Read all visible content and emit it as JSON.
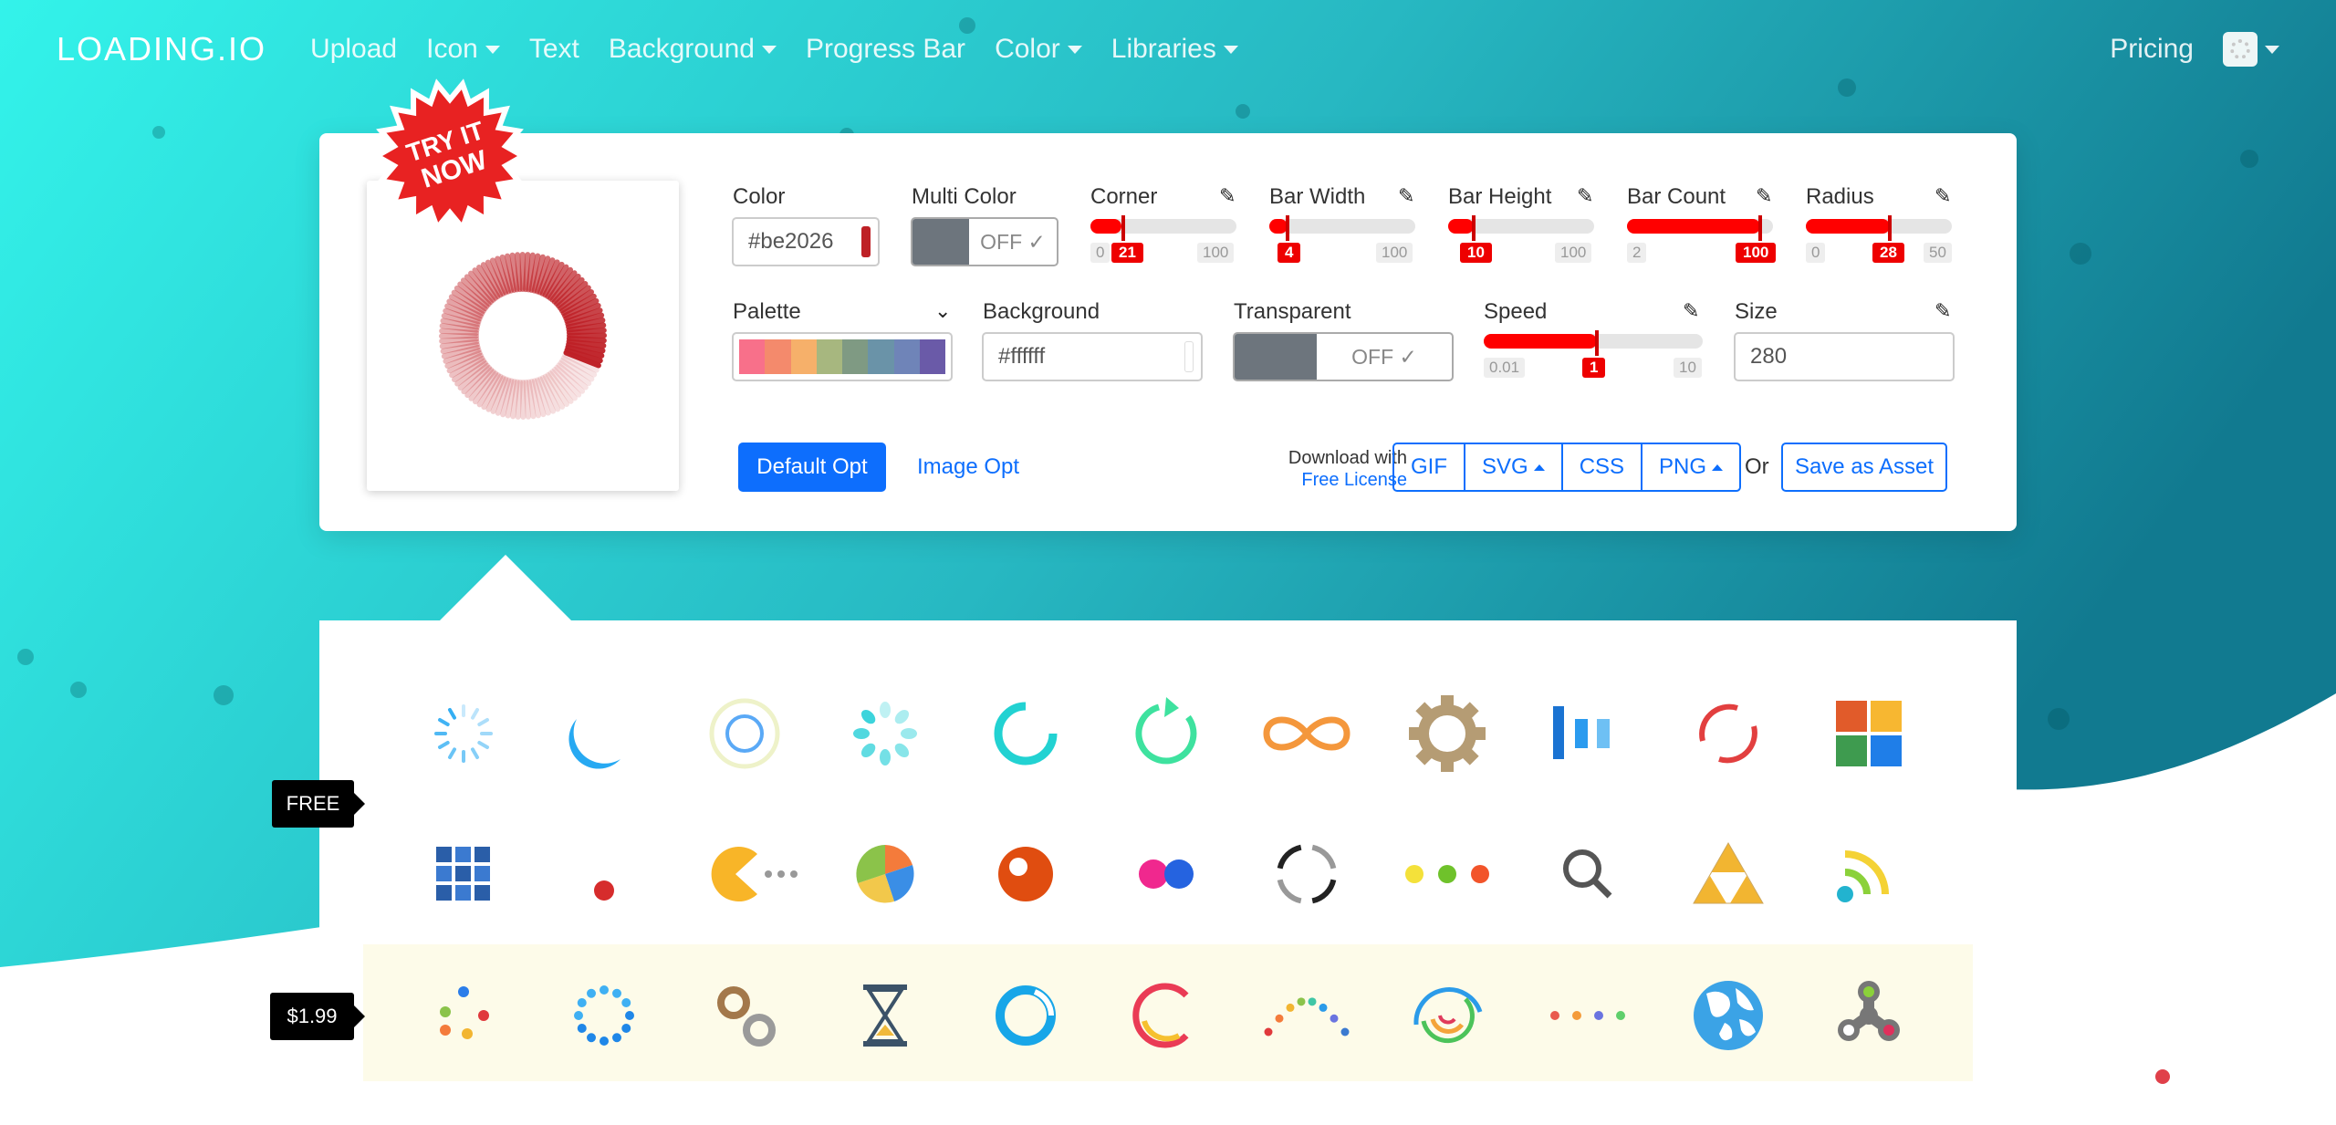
{
  "nav": {
    "logo": "LOADING.IO",
    "items": [
      {
        "label": "Upload",
        "dropdown": false
      },
      {
        "label": "Icon",
        "dropdown": true
      },
      {
        "label": "Text",
        "dropdown": false
      },
      {
        "label": "Background",
        "dropdown": true
      },
      {
        "label": "Progress Bar",
        "dropdown": false
      },
      {
        "label": "Color",
        "dropdown": true
      },
      {
        "label": "Libraries",
        "dropdown": true
      }
    ],
    "pricing": "Pricing"
  },
  "badge": {
    "line1": "TRY IT",
    "line2": "NOW"
  },
  "controls": {
    "color": {
      "label": "Color",
      "value": "#be2026"
    },
    "multi_color": {
      "label": "Multi Color",
      "value": "OFF"
    },
    "corner": {
      "label": "Corner",
      "min": "0",
      "max": "100",
      "value": "21",
      "fraction": 0.21
    },
    "bar_width": {
      "label": "Bar Width",
      "min": "0",
      "max": "100",
      "value": "4",
      "fraction": 0.04
    },
    "bar_height": {
      "label": "Bar Height",
      "min": "0",
      "max": "100",
      "value": "10",
      "fraction": 0.1
    },
    "bar_count": {
      "label": "Bar Count",
      "min": "2",
      "max": "100",
      "value": "100",
      "fraction": 1.0
    },
    "radius": {
      "label": "Radius",
      "min": "0",
      "max": "50",
      "value": "28",
      "fraction": 0.56
    },
    "palette": {
      "label": "Palette",
      "colors": [
        "#f8708a",
        "#f48a6c",
        "#f6b06a",
        "#a7b77f",
        "#7f9a83",
        "#6a93a8",
        "#6f84b8",
        "#6a5aa8"
      ]
    },
    "background": {
      "label": "Background",
      "value": "#ffffff"
    },
    "transparent": {
      "label": "Transparent",
      "value": "OFF"
    },
    "speed": {
      "label": "Speed",
      "min": "0.01",
      "max": "10",
      "value": "1",
      "fraction": 0.52
    },
    "size": {
      "label": "Size",
      "value": "280"
    }
  },
  "actions": {
    "default_opt": "Default Opt",
    "image_opt": "Image Opt",
    "download_with": "Download with",
    "free_license": "Free License",
    "formats": [
      "GIF",
      "SVG",
      "CSS",
      "PNG"
    ],
    "or": "Or",
    "save_as_asset": "Save as Asset"
  },
  "gallery": {
    "free_tag": "FREE",
    "paid_tag": "$1.99"
  },
  "colors": {
    "accent": "#0d6efd",
    "spinner": "#be2026",
    "bg_light": "#2ee8e2",
    "bg_dark": "#138596"
  }
}
